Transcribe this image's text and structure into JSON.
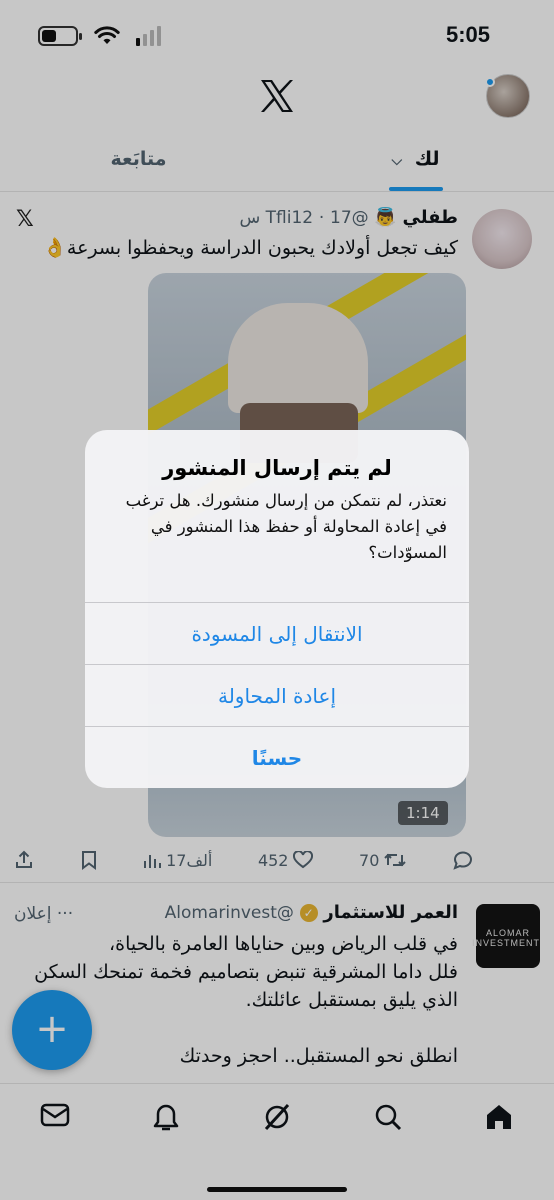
{
  "status_bar": {
    "time": "5:05"
  },
  "tabs": [
    {
      "label": "لك",
      "active": true
    },
    {
      "label": "متابَعة",
      "active": false
    }
  ],
  "tweet1": {
    "name": "طفلي",
    "emoji": "👼",
    "handle": "@Tfli12",
    "time": "17 س",
    "text": "كيف تجعل أولادك يحبون الدراسة ويحفظوا بسرعة👌",
    "video_duration": "1:14",
    "views": "17ألف",
    "likes": "452",
    "reposts": "70"
  },
  "tweet2": {
    "name": "العمر للاستثمار",
    "handle": "@Alomarinvest",
    "ad_label": "إعلان",
    "more": "···",
    "avatar_text": "ALOMAR INVESTMENT",
    "line1": "في قلب الرياض وبين حناياها العامرة بالحياة،",
    "line2": "فلل داما المشرقية تنبض بتصاميم فخمة تمنحك السكن",
    "line3": "الذي يليق بمستقبل عائلتك.",
    "line4": "انطلق نحو المستقبل.. احجز وحدتك"
  },
  "dialog": {
    "title": "لم يتم إرسال المنشور",
    "message": "نعتذر، لم نتمكن من إرسال منشورك. هل ترغب في إعادة المحاولة أو حفظ هذا المنشور في المسوّدات؟",
    "buttons": {
      "go_to_draft": "الانتقال إلى المسودة",
      "retry": "إعادة المحاولة",
      "ok": "حسنًا"
    }
  },
  "icons": {
    "x_logo": "x-logo-icon",
    "fab": "plus-icon",
    "nav": [
      "mail-icon",
      "bell-icon",
      "grok-icon",
      "search-icon",
      "home-icon"
    ]
  },
  "colors": {
    "accent": "#1d9bf0",
    "dialog_button": "#1f87e6"
  }
}
